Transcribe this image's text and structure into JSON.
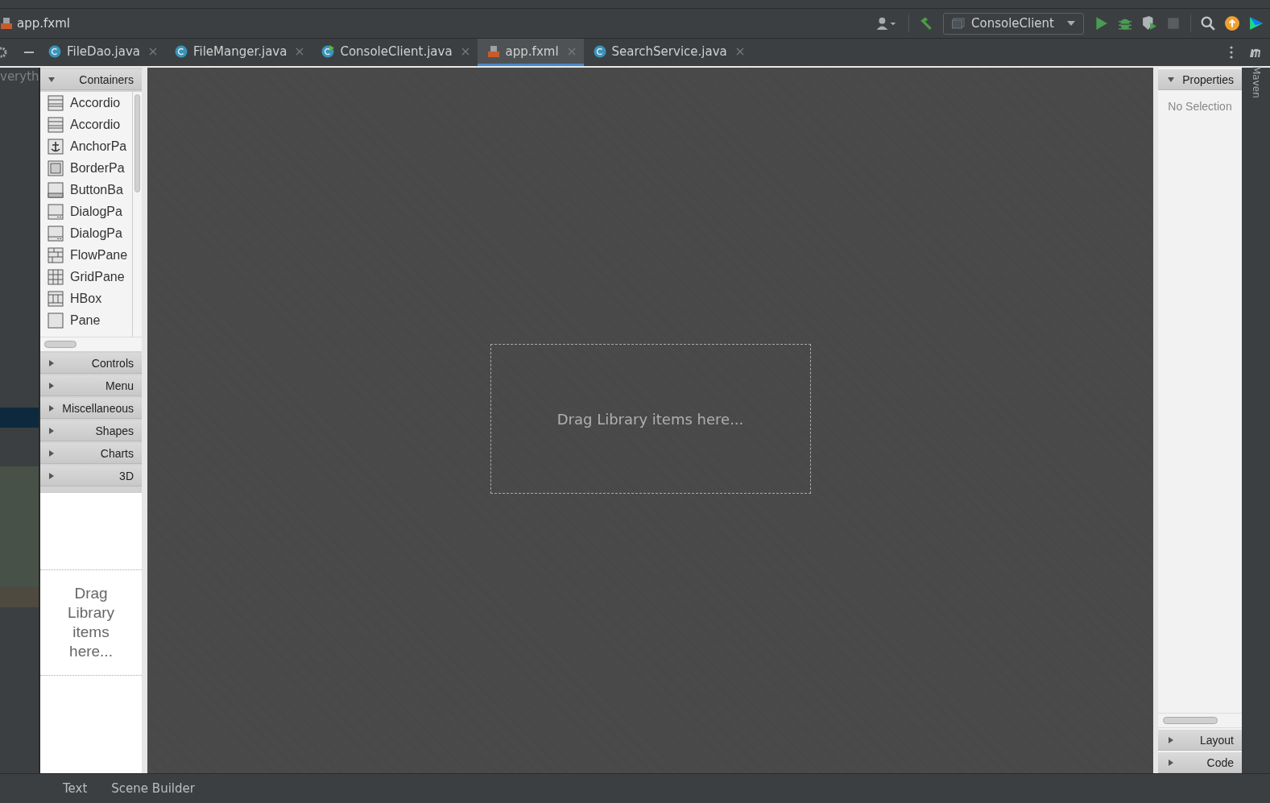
{
  "breadcrumb": {
    "file": "app.fxml"
  },
  "toolbar": {
    "run_config": "ConsoleClient"
  },
  "tabs": [
    {
      "label": "FileDao.java",
      "kind": "class",
      "selected": false
    },
    {
      "label": "FileManger.java",
      "kind": "class",
      "selected": false
    },
    {
      "label": "ConsoleClient.java",
      "kind": "runnable",
      "selected": false
    },
    {
      "label": "app.fxml",
      "kind": "fxml",
      "selected": true
    },
    {
      "label": "SearchService.java",
      "kind": "class",
      "selected": false
    }
  ],
  "left_strip": {
    "search_text": "veryth"
  },
  "library": {
    "sections": [
      {
        "label": "Containers",
        "expanded": true,
        "items": [
          {
            "label": "Accordio",
            "kind": "rows"
          },
          {
            "label": "Accordio",
            "kind": "rows"
          },
          {
            "label": "AnchorPa",
            "kind": "anchor"
          },
          {
            "label": "BorderPa",
            "kind": "border"
          },
          {
            "label": "ButtonBa",
            "kind": "buttonbar"
          },
          {
            "label": "DialogPa",
            "kind": "dialog"
          },
          {
            "label": "DialogPa",
            "kind": "dialog"
          },
          {
            "label": "FlowPane",
            "kind": "flow"
          },
          {
            "label": "GridPane",
            "kind": "grid"
          },
          {
            "label": "HBox",
            "kind": "hbox"
          },
          {
            "label": "Pane",
            "kind": "pane"
          }
        ]
      },
      {
        "label": "Controls",
        "expanded": false
      },
      {
        "label": "Menu",
        "expanded": false
      },
      {
        "label": "Miscellaneous",
        "expanded": false
      },
      {
        "label": "Shapes",
        "expanded": false
      },
      {
        "label": "Charts",
        "expanded": false
      },
      {
        "label": "3D",
        "expanded": false
      }
    ],
    "hierarchy_hint": "Drag Library items here..."
  },
  "canvas": {
    "hint": "Drag Library items here..."
  },
  "inspector": {
    "sections": [
      {
        "label": "Properties",
        "expanded": true,
        "empty_text": "No Selection"
      },
      {
        "label": "Layout",
        "expanded": false
      },
      {
        "label": "Code",
        "expanded": false
      }
    ]
  },
  "right_strip": {
    "label": "Maven"
  },
  "bottom_tabs": [
    {
      "label": "Text"
    },
    {
      "label": "Scene Builder"
    }
  ]
}
